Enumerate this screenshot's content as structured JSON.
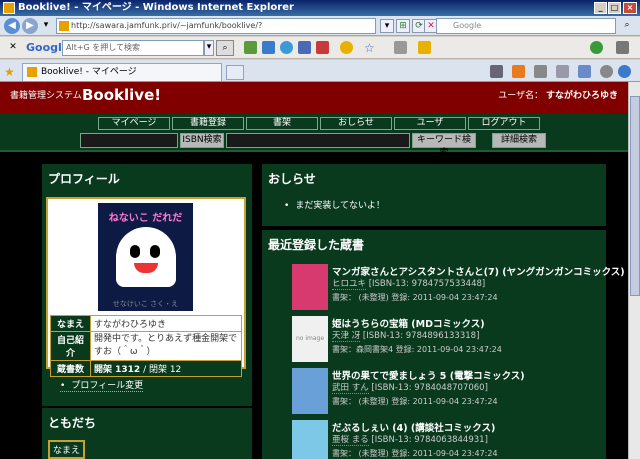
{
  "window": {
    "title": "Booklive! - マイページ - Windows Internet Explorer",
    "address": "http://sawara.jamfunk.priv/~jamfunk/booklive/?",
    "search_placeholder": "Google"
  },
  "google_toolbar": {
    "logo": "Google",
    "input_placeholder": "Alt+G を押して検索"
  },
  "tab": {
    "label": "Booklive! - マイページ"
  },
  "site": {
    "system_name": "書籍管理システム",
    "logo": "Booklive!",
    "user_label": "ユーザ名：",
    "user_name": "すながわひろゆき"
  },
  "nav": {
    "items": [
      "マイページ",
      "書籍登録",
      "書架",
      "おしらせ",
      "ユーザ",
      "ログアウト"
    ],
    "isbn_button": "ISBN検索",
    "keyword_button": "キーワード検索",
    "advanced_button": "詳細検索"
  },
  "profile": {
    "title": "プロフィール",
    "picture_title": "ねないこ だれだ",
    "picture_footer": "せなけいこ さく・え",
    "rows": [
      {
        "label": "なまえ",
        "value": "すながわひろゆき"
      },
      {
        "label": "自己紹介",
        "value": "開発中です。とりあえず種金開架ですお（＾ω＾）"
      },
      {
        "label": "蔵書数",
        "value_strong": "開架 1312",
        "value_rest": "/ 閉架 12"
      }
    ],
    "edit_link": "プロフィール変更"
  },
  "friends": {
    "title": "ともだち",
    "first_label": "なまえ"
  },
  "news": {
    "title": "おしらせ",
    "items": [
      "まだ実装してないよ！"
    ]
  },
  "recent": {
    "title": "最近登録した蔵書",
    "no_image_text": "no image",
    "books": [
      {
        "title": "マンガ家さんとアシスタントさんと(7) (ヤングガンガンコミックス)",
        "author": "ヒロユキ",
        "isbn": "[ISBN-13: 9784757533448]",
        "shelf": "書架： (未整理)",
        "date": "登録: 2011-09-04 23:47:24",
        "cover_color": "#d63a6e"
      },
      {
        "title": "姫はうちらの宝箱 (MDコミックス)",
        "author": "天津 冴",
        "isbn": "[ISBN-13: 9784896133318]",
        "shelf": "書架：森岡書架4",
        "date": "登録: 2011-09-04 23:47:24",
        "cover_color": "#f0f0f0"
      },
      {
        "title": "世界の果てで愛ましょう 5 (電撃コミックス)",
        "author": "武田 すん",
        "isbn": "[ISBN-13: 9784048707060]",
        "shelf": "書架： (未整理)",
        "date": "登録: 2011-09-04 23:47:24",
        "cover_color": "#6aa0d8"
      },
      {
        "title": "だぶるしぇい (4) (講談社コミックス)",
        "author": "亜桜 まる",
        "isbn": "[ISBN-13: 9784063844931]",
        "shelf": "書架： (未整理)",
        "date": "登録: 2011-09-04 23:47:24",
        "cover_color": "#7cc8e6"
      }
    ]
  },
  "colors": {
    "header_bg": "#800000",
    "panel_bg": "#0a3a1e",
    "page_bg": "#000000",
    "accent_gold": "#c8a032"
  }
}
